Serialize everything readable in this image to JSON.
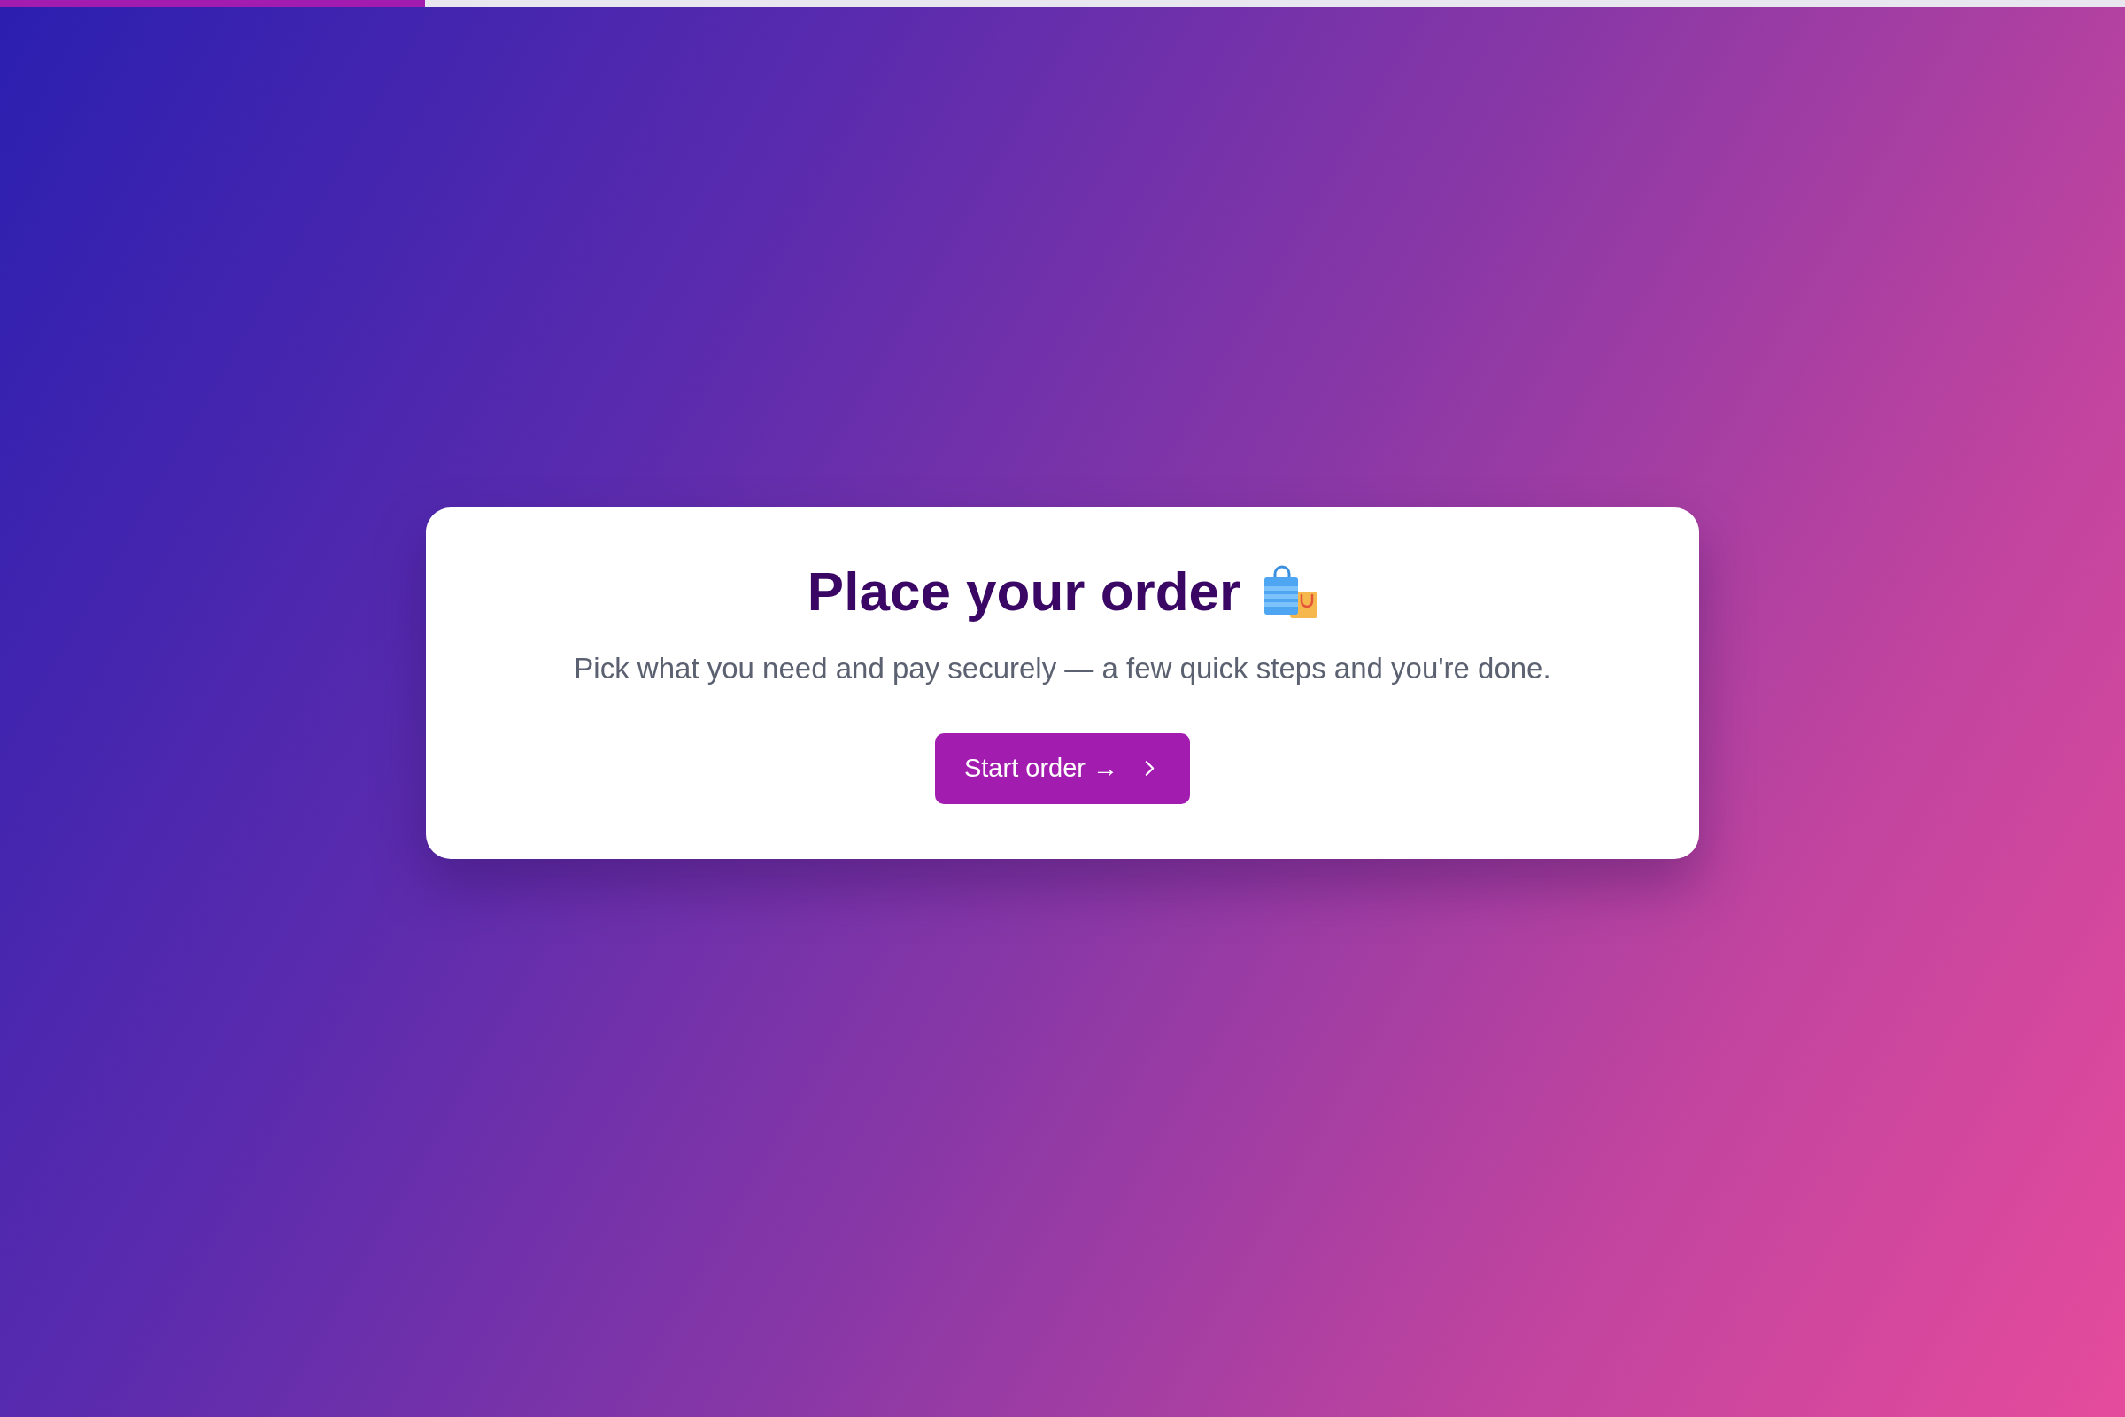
{
  "progress": {
    "level": 0.2
  },
  "card": {
    "title": "Place your order",
    "subtitle": "Pick what you need and pay securely — a few quick steps and you're done.",
    "button": {
      "label": "Start order →"
    }
  }
}
